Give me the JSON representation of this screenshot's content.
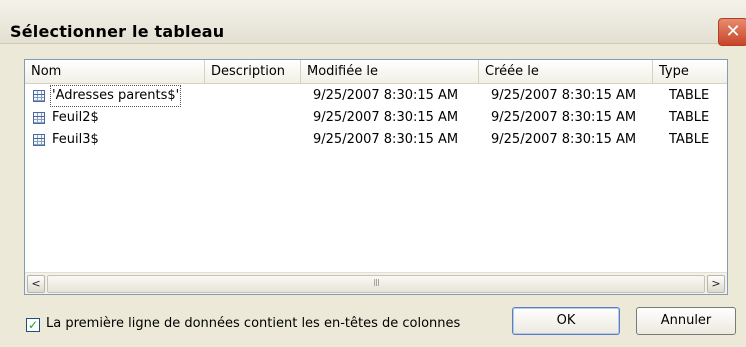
{
  "window": {
    "title": "Sélectionner le tableau",
    "close_label": "✕"
  },
  "table": {
    "columns": [
      "Nom",
      "Description",
      "Modifiée le",
      "Créée le",
      "Type"
    ],
    "rows": [
      {
        "name": "'Adresses parents$'",
        "description": "",
        "modified": "9/25/2007 8:30:15 AM",
        "created": "9/25/2007 8:30:15 AM",
        "type": "TABLE",
        "icon": "table-icon",
        "selected": true
      },
      {
        "name": "Feuil2$",
        "description": "",
        "modified": "9/25/2007 8:30:15 AM",
        "created": "9/25/2007 8:30:15 AM",
        "type": "TABLE",
        "icon": "table-icon",
        "selected": false
      },
      {
        "name": "Feuil3$",
        "description": "",
        "modified": "9/25/2007 8:30:15 AM",
        "created": "9/25/2007 8:30:15 AM",
        "type": "TABLE",
        "icon": "table-icon",
        "selected": false
      }
    ]
  },
  "scrollbar": {
    "left_arrow": "<",
    "right_arrow": ">",
    "thumb_grip": "III"
  },
  "footer": {
    "checkbox_checked": true,
    "checkbox_mark": "✓",
    "checkbox_label": "La première ligne de données contient les en-têtes de colonnes",
    "ok_label": "OK",
    "cancel_label": "Annuler"
  }
}
